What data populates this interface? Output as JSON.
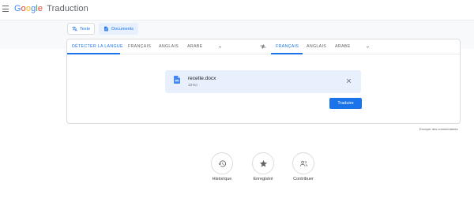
{
  "header": {
    "logo_letters": [
      "G",
      "o",
      "o",
      "g",
      "l",
      "e"
    ],
    "product": "Traduction"
  },
  "mode_tabs": [
    {
      "label": "Texte",
      "icon": "translate-icon",
      "active": false
    },
    {
      "label": "Documents",
      "icon": "document-icon",
      "active": true
    }
  ],
  "source_langs": [
    "DÉTECTER LA LANGUE",
    "FRANÇAIS",
    "ANGLAIS",
    "ARABE"
  ],
  "target_langs": [
    "FRANÇAIS",
    "ANGLAIS",
    "ARABE"
  ],
  "file": {
    "name": "recette.docx",
    "size": "13 Ko"
  },
  "translate_button": "Traduire",
  "feedback_link": "Envoyer des commentaires",
  "actions": [
    {
      "label": "Historique",
      "icon": "history-icon"
    },
    {
      "label": "Enregistré",
      "icon": "star-icon"
    },
    {
      "label": "Contribuer",
      "icon": "contribute-icon"
    }
  ],
  "colors": {
    "accent": "#1a73e8",
    "file_box_bg": "#e8f0fe",
    "band_bg": "#f8f9fa"
  }
}
